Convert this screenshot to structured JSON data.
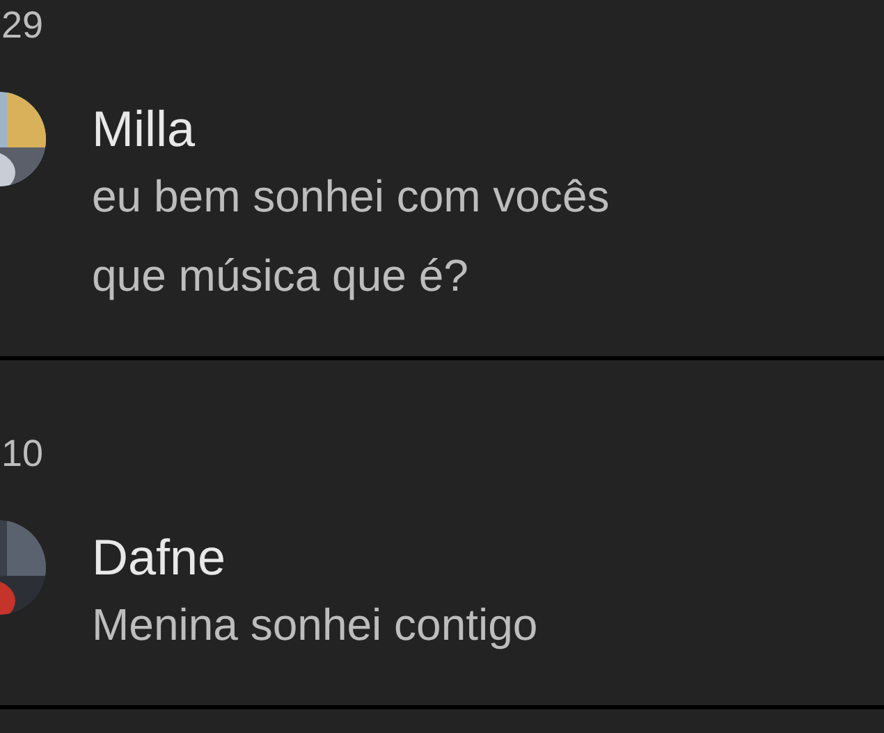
{
  "comments": [
    {
      "count": "29",
      "author": "Milla",
      "lines": [
        "eu bem sonhei com vocês",
        "que música que é?"
      ]
    },
    {
      "count": "10",
      "author": "Dafne",
      "lines": [
        "Menina sonhei contigo"
      ]
    }
  ]
}
